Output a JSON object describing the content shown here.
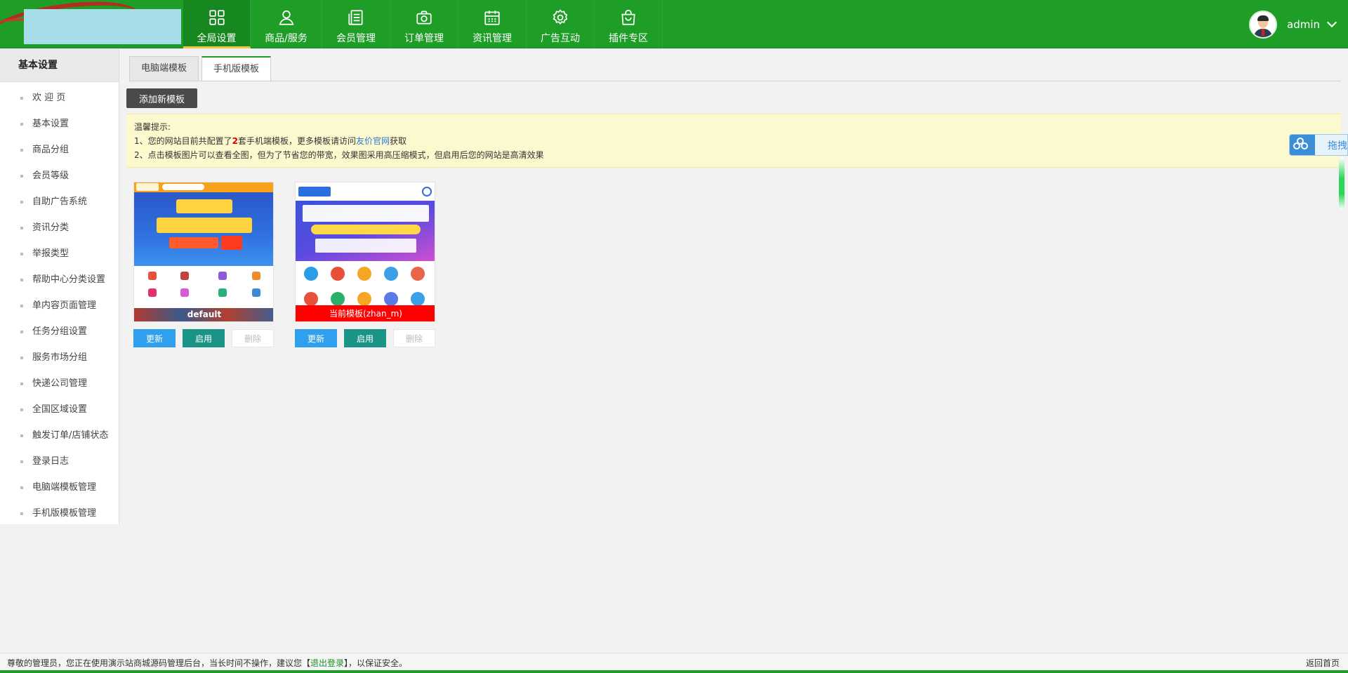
{
  "header": {
    "nav": [
      {
        "label": "全局设置",
        "icon": "grid-icon"
      },
      {
        "label": "商品/服务",
        "icon": "user-icon"
      },
      {
        "label": "会员管理",
        "icon": "document-icon"
      },
      {
        "label": "订单管理",
        "icon": "camera-icon"
      },
      {
        "label": "资讯管理",
        "icon": "calendar-icon"
      },
      {
        "label": "广告互动",
        "icon": "gear-icon"
      },
      {
        "label": "插件专区",
        "icon": "bag-icon"
      }
    ],
    "user": {
      "name": "admin"
    }
  },
  "sidebar": {
    "title": "基本设置",
    "items": [
      {
        "label": "欢 迎 页"
      },
      {
        "label": "基本设置"
      },
      {
        "label": "商品分组"
      },
      {
        "label": "会员等级"
      },
      {
        "label": "自助广告系统"
      },
      {
        "label": "资讯分类"
      },
      {
        "label": "举报类型"
      },
      {
        "label": "帮助中心分类设置"
      },
      {
        "label": "单内容页面管理"
      },
      {
        "label": "任务分组设置"
      },
      {
        "label": "服务市场分组"
      },
      {
        "label": "快递公司管理"
      },
      {
        "label": "全国区域设置"
      },
      {
        "label": "触发订单/店铺状态"
      },
      {
        "label": "登录日志"
      },
      {
        "label": "电脑端模板管理"
      },
      {
        "label": "手机版模板管理"
      }
    ]
  },
  "tabs": [
    {
      "label": "电脑端模板"
    },
    {
      "label": "手机版模板"
    }
  ],
  "add_button": "添加新模板",
  "tips": {
    "title": "温馨提示:",
    "line1_prefix": "1、您的网站目前共配置了",
    "line1_count": "2",
    "line1_middle": "套手机端模板，更多模板请访问",
    "line1_link": "友价官网",
    "line1_suffix": "获取",
    "line2": "2、点击模板图片可以查看全图，但为了节省您的带宽，效果图采用高压缩模式，但启用后您的网站是高清效果"
  },
  "templates": [
    {
      "caption": "default",
      "update": "更新",
      "enable": "启用",
      "delete": "删除"
    },
    {
      "caption": "当前模板(zhan_m)",
      "update": "更新",
      "enable": "启用",
      "delete": "删除"
    }
  ],
  "float_widget": {
    "label": "拖拽"
  },
  "footer": {
    "notice_prefix": "尊敬的管理员，您正在使用演示站商城源码管理后台，当长时间不操作，建议您【",
    "logout": "退出登录",
    "notice_suffix": "】，以保证安全。",
    "back_home": "返回首页"
  },
  "colors": {
    "header_green": "#1e9e27",
    "update_blue": "#2ea0ee",
    "enable_teal": "#1a9486",
    "current_red": "#ff0000"
  }
}
